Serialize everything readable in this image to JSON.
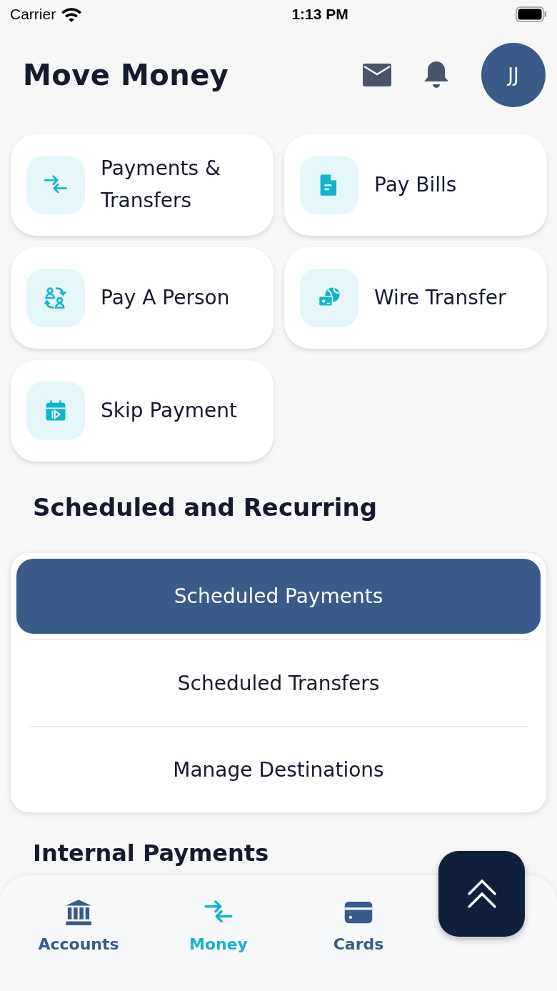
{
  "status_bar": {
    "carrier": "Carrier",
    "time": "1:13 PM"
  },
  "header": {
    "title": "Move Money",
    "avatar_initials": "JJ"
  },
  "tiles": [
    {
      "label": "Payments & Transfers"
    },
    {
      "label": "Pay Bills"
    },
    {
      "label": "Pay A Person"
    },
    {
      "label": "Wire Transfer"
    },
    {
      "label": "Skip Payment"
    }
  ],
  "scheduled": {
    "title": "Scheduled and Recurring",
    "items": [
      {
        "label": "Scheduled Payments",
        "selected": true
      },
      {
        "label": "Scheduled Transfers",
        "selected": false
      },
      {
        "label": "Manage Destinations",
        "selected": false
      }
    ]
  },
  "next_section": {
    "title": "Internal Payments"
  },
  "tab_bar": [
    {
      "label": "Accounts",
      "selected": false
    },
    {
      "label": "Money",
      "selected": true
    },
    {
      "label": "Cards",
      "selected": false
    }
  ]
}
